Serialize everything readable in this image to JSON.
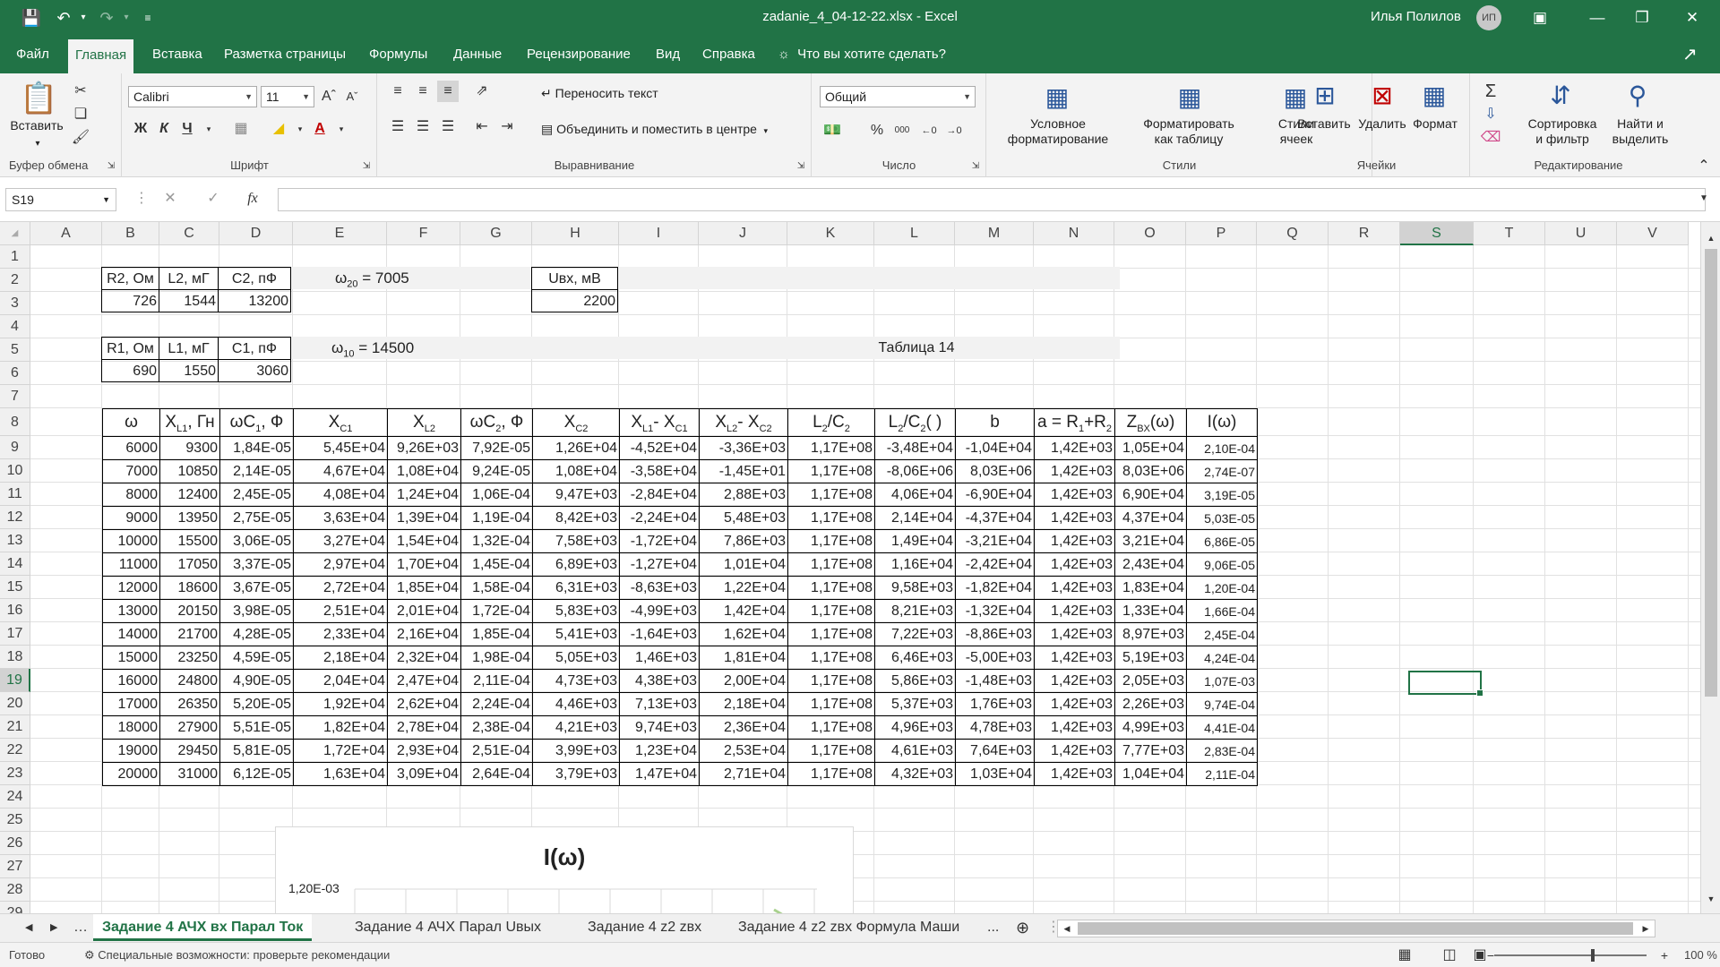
{
  "window": {
    "title": "zadanie_4_04-12-22.xlsx  -  Excel",
    "user_name": "Илья Полилов",
    "user_initials": "ИП"
  },
  "menu": {
    "tabs": [
      "Файл",
      "Главная",
      "Вставка",
      "Разметка страницы",
      "Формулы",
      "Данные",
      "Рецензирование",
      "Вид",
      "Справка"
    ],
    "tell_me": "Что вы хотите сделать?"
  },
  "ribbon": {
    "clipboard": {
      "paste": "Вставить",
      "label": "Буфер обмена"
    },
    "font": {
      "name": "Calibri",
      "size": "11",
      "bold": "Ж",
      "italic": "К",
      "underline": "Ч",
      "label": "Шрифт"
    },
    "alignment": {
      "wrap": "Переносить текст",
      "merge": "Объединить и поместить в центре",
      "label": "Выравнивание"
    },
    "number": {
      "format": "Общий",
      "label": "Число"
    },
    "styles": {
      "conditional": "Условное\nформатирование",
      "conditional_1": "Условное",
      "conditional_2": "форматирование",
      "table_1": "Форматировать",
      "table_2": "как таблицу",
      "cell_1": "Стили",
      "cell_2": "ячеек",
      "label": "Стили"
    },
    "cells": {
      "insert": "Вставить",
      "delete": "Удалить",
      "format": "Формат",
      "label": "Ячейки"
    },
    "editing": {
      "sort_1": "Сортировка",
      "sort_2": "и фильтр",
      "find_1": "Найти и",
      "find_2": "выделить",
      "label": "Редактирование"
    }
  },
  "formula_bar": {
    "name_box": "S19",
    "fx": "fx",
    "value": ""
  },
  "columns": [
    "A",
    "B",
    "C",
    "D",
    "E",
    "F",
    "G",
    "H",
    "I",
    "J",
    "K",
    "L",
    "M",
    "N",
    "O",
    "P",
    "Q",
    "R",
    "S",
    "T",
    "U",
    "V"
  ],
  "rows": [
    "1",
    "2",
    "3",
    "4",
    "5",
    "6",
    "7",
    "8",
    "9",
    "10",
    "11",
    "12",
    "13",
    "14",
    "15",
    "16",
    "17",
    "18",
    "19",
    "20",
    "21",
    "22",
    "23",
    "24",
    "25",
    "26",
    "27",
    "28",
    "29"
  ],
  "selected": {
    "col": "S",
    "row": "19"
  },
  "params2": {
    "headers": [
      "R2,  Ом",
      "L2, мГ",
      "C2, пФ"
    ],
    "values": [
      "726",
      "1544",
      "13200"
    ],
    "omega20_sym": "ω",
    "omega20_sub": "20",
    "omega20_val": " = 7005",
    "uvx_header": "Uвх, мВ",
    "uvx_value": "2200"
  },
  "params1": {
    "headers": [
      "R1,  Ом",
      "L1, мГ",
      "C1, пФ"
    ],
    "values": [
      "690",
      "1550",
      "3060"
    ],
    "omega10_sym": "ω",
    "omega10_sub": "10",
    "omega10_val": " = 14500",
    "table_label": "Таблица 14"
  },
  "table": {
    "headers": {
      "c1": "ω",
      "c2a": "X",
      "c2b": "L1",
      "c2c": ", Гн",
      "c3a": "ωC",
      "c3b": "1",
      "c3c": ", Ф",
      "c4a": "X",
      "c4b": "C1",
      "c5a": "X",
      "c5b": "L2",
      "c6a": "ωC",
      "c6b": "2",
      "c6c": ", Ф",
      "c7a": "X",
      "c7b": "C2",
      "c8a": "X",
      "c8b": "L1",
      "c8c": "- X",
      "c8d": "C1",
      "c9a": "X",
      "c9b": "L2",
      "c9c": "- X",
      "c9d": "C2",
      "c10a": "L",
      "c10b": "2",
      "c10c": "/C",
      "c10d": "2",
      "c11a": "L",
      "c11b": "2",
      "c11c": "/C",
      "c11d": "2",
      "c11e": "(  )",
      "c12": "b",
      "c13a": "a = R",
      "c13b": "1",
      "c13c": "+R",
      "c13d": "2",
      "c14a": "Z",
      "c14b": "BX",
      "c14c": "(ω)",
      "c15": "I(ω)"
    },
    "rows": [
      [
        "6000",
        "9300",
        "1,84E-05",
        "5,45E+04",
        "9,26E+03",
        "7,92E-05",
        "1,26E+04",
        "-4,52E+04",
        "-3,36E+03",
        "1,17E+08",
        "-3,48E+04",
        "-1,04E+04",
        "1,42E+03",
        "1,05E+04",
        "2,10E-04"
      ],
      [
        "7000",
        "10850",
        "2,14E-05",
        "4,67E+04",
        "1,08E+04",
        "9,24E-05",
        "1,08E+04",
        "-3,58E+04",
        "-1,45E+01",
        "1,17E+08",
        "-8,06E+06",
        "8,03E+06",
        "1,42E+03",
        "8,03E+06",
        "2,74E-07"
      ],
      [
        "8000",
        "12400",
        "2,45E-05",
        "4,08E+04",
        "1,24E+04",
        "1,06E-04",
        "9,47E+03",
        "-2,84E+04",
        "2,88E+03",
        "1,17E+08",
        "4,06E+04",
        "-6,90E+04",
        "1,42E+03",
        "6,90E+04",
        "3,19E-05"
      ],
      [
        "9000",
        "13950",
        "2,75E-05",
        "3,63E+04",
        "1,39E+04",
        "1,19E-04",
        "8,42E+03",
        "-2,24E+04",
        "5,48E+03",
        "1,17E+08",
        "2,14E+04",
        "-4,37E+04",
        "1,42E+03",
        "4,37E+04",
        "5,03E-05"
      ],
      [
        "10000",
        "15500",
        "3,06E-05",
        "3,27E+04",
        "1,54E+04",
        "1,32E-04",
        "7,58E+03",
        "-1,72E+04",
        "7,86E+03",
        "1,17E+08",
        "1,49E+04",
        "-3,21E+04",
        "1,42E+03",
        "3,21E+04",
        "6,86E-05"
      ],
      [
        "11000",
        "17050",
        "3,37E-05",
        "2,97E+04",
        "1,70E+04",
        "1,45E-04",
        "6,89E+03",
        "-1,27E+04",
        "1,01E+04",
        "1,17E+08",
        "1,16E+04",
        "-2,42E+04",
        "1,42E+03",
        "2,43E+04",
        "9,06E-05"
      ],
      [
        "12000",
        "18600",
        "3,67E-05",
        "2,72E+04",
        "1,85E+04",
        "1,58E-04",
        "6,31E+03",
        "-8,63E+03",
        "1,22E+04",
        "1,17E+08",
        "9,58E+03",
        "-1,82E+04",
        "1,42E+03",
        "1,83E+04",
        "1,20E-04"
      ],
      [
        "13000",
        "20150",
        "3,98E-05",
        "2,51E+04",
        "2,01E+04",
        "1,72E-04",
        "5,83E+03",
        "-4,99E+03",
        "1,42E+04",
        "1,17E+08",
        "8,21E+03",
        "-1,32E+04",
        "1,42E+03",
        "1,33E+04",
        "1,66E-04"
      ],
      [
        "14000",
        "21700",
        "4,28E-05",
        "2,33E+04",
        "2,16E+04",
        "1,85E-04",
        "5,41E+03",
        "-1,64E+03",
        "1,62E+04",
        "1,17E+08",
        "7,22E+03",
        "-8,86E+03",
        "1,42E+03",
        "8,97E+03",
        "2,45E-04"
      ],
      [
        "15000",
        "23250",
        "4,59E-05",
        "2,18E+04",
        "2,32E+04",
        "1,98E-04",
        "5,05E+03",
        "1,46E+03",
        "1,81E+04",
        "1,17E+08",
        "6,46E+03",
        "-5,00E+03",
        "1,42E+03",
        "5,19E+03",
        "4,24E-04"
      ],
      [
        "16000",
        "24800",
        "4,90E-05",
        "2,04E+04",
        "2,47E+04",
        "2,11E-04",
        "4,73E+03",
        "4,38E+03",
        "2,00E+04",
        "1,17E+08",
        "5,86E+03",
        "-1,48E+03",
        "1,42E+03",
        "2,05E+03",
        "1,07E-03"
      ],
      [
        "17000",
        "26350",
        "5,20E-05",
        "1,92E+04",
        "2,62E+04",
        "2,24E-04",
        "4,46E+03",
        "7,13E+03",
        "2,18E+04",
        "1,17E+08",
        "5,37E+03",
        "1,76E+03",
        "1,42E+03",
        "2,26E+03",
        "9,74E-04"
      ],
      [
        "18000",
        "27900",
        "5,51E-05",
        "1,82E+04",
        "2,78E+04",
        "2,38E-04",
        "4,21E+03",
        "9,74E+03",
        "2,36E+04",
        "1,17E+08",
        "4,96E+03",
        "4,78E+03",
        "1,42E+03",
        "4,99E+03",
        "4,41E-04"
      ],
      [
        "19000",
        "29450",
        "5,81E-05",
        "1,72E+04",
        "2,93E+04",
        "2,51E-04",
        "3,99E+03",
        "1,23E+04",
        "2,53E+04",
        "1,17E+08",
        "4,61E+03",
        "7,64E+03",
        "1,42E+03",
        "7,77E+03",
        "2,83E-04"
      ],
      [
        "20000",
        "31000",
        "6,12E-05",
        "1,63E+04",
        "3,09E+04",
        "2,64E-04",
        "3,79E+03",
        "1,47E+04",
        "2,71E+04",
        "1,17E+08",
        "4,32E+03",
        "1,03E+04",
        "1,42E+03",
        "1,04E+04",
        "2,11E-04"
      ]
    ]
  },
  "chart": {
    "title": "I(ω)",
    "ytick_top": "1,20E-03",
    "line_color": "#a9d18e"
  },
  "sheets": {
    "tabs": [
      "Задание 4 АЧХ вх Парал Ток",
      "Задание 4 АЧХ Парал Uвых",
      "Задание 4 z2 zвх",
      "Задание 4 z2 zвх  Формула Маши",
      "..."
    ],
    "active": 0
  },
  "status": {
    "ready": "Готово",
    "accessibility": "Специальные возможности: проверьте рекомендации",
    "zoom": "100 %"
  },
  "colors": {
    "accent": "#217346"
  }
}
